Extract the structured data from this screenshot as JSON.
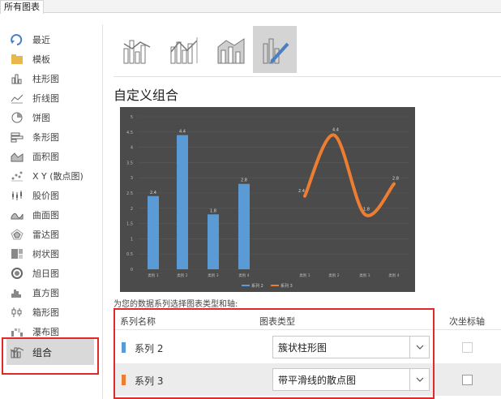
{
  "tab_label": "所有图表",
  "nav_items": [
    {
      "label": "最近",
      "icon": "recent-icon"
    },
    {
      "label": "模板",
      "icon": "folder-icon"
    },
    {
      "label": "柱形图",
      "icon": "column-chart-icon"
    },
    {
      "label": "折线图",
      "icon": "line-chart-icon"
    },
    {
      "label": "饼图",
      "icon": "pie-chart-icon"
    },
    {
      "label": "条形图",
      "icon": "bar-chart-icon"
    },
    {
      "label": "面积图",
      "icon": "area-chart-icon"
    },
    {
      "label": "X Y (散点图)",
      "icon": "scatter-chart-icon"
    },
    {
      "label": "股价图",
      "icon": "stock-chart-icon"
    },
    {
      "label": "曲面图",
      "icon": "surface-chart-icon"
    },
    {
      "label": "雷达图",
      "icon": "radar-chart-icon"
    },
    {
      "label": "树状图",
      "icon": "treemap-icon"
    },
    {
      "label": "旭日图",
      "icon": "sunburst-icon"
    },
    {
      "label": "直方图",
      "icon": "histogram-icon"
    },
    {
      "label": "箱形图",
      "icon": "box-whisker-icon"
    },
    {
      "label": "瀑布图",
      "icon": "waterfall-icon"
    },
    {
      "label": "组合",
      "icon": "combo-chart-icon",
      "selected": true
    }
  ],
  "section_title": "自定义组合",
  "chart_data": {
    "type": "combo",
    "y_ticks": [
      "0",
      "0.5",
      "1",
      "1.5",
      "2",
      "2.5",
      "3",
      "3.5",
      "4",
      "4.5",
      "5"
    ],
    "ylim": [
      0,
      5
    ],
    "bar_series": {
      "name": "系列 2",
      "categories": [
        "类别 1",
        "类别 2",
        "类别 3",
        "类别 4"
      ],
      "values": [
        2.4,
        4.4,
        1.8,
        2.8
      ],
      "labels": [
        "2.4",
        "4.4",
        "1.8",
        "2.8"
      ],
      "color": "#5b9bd5"
    },
    "scatter_series": {
      "name": "系列 3",
      "categories": [
        "类别 1",
        "类别 2",
        "类别 3",
        "类别 4"
      ],
      "values": [
        2.4,
        4.4,
        1.8,
        2.8
      ],
      "labels": [
        "2.4",
        "4.4",
        "1.8",
        "2.8"
      ],
      "color": "#ed7d31"
    },
    "legend": [
      "系列 2",
      "系列 3"
    ],
    "legend_position": "bottom"
  },
  "prompt": "为您的数据系列选择图表类型和轴:",
  "table": {
    "col_series": "系列名称",
    "col_type": "图表类型",
    "col_axis": "次坐标轴",
    "rows": [
      {
        "name": "系列 2",
        "type": "簇状柱形图",
        "color": "#5b9bd5",
        "secondary_axis": false
      },
      {
        "name": "系列 3",
        "type": "带平滑线的散点图",
        "color": "#ed7d31",
        "secondary_axis": false
      }
    ]
  },
  "colors": {
    "highlight_box": "#e0292b",
    "selected_bg": "#d9d9d9"
  }
}
